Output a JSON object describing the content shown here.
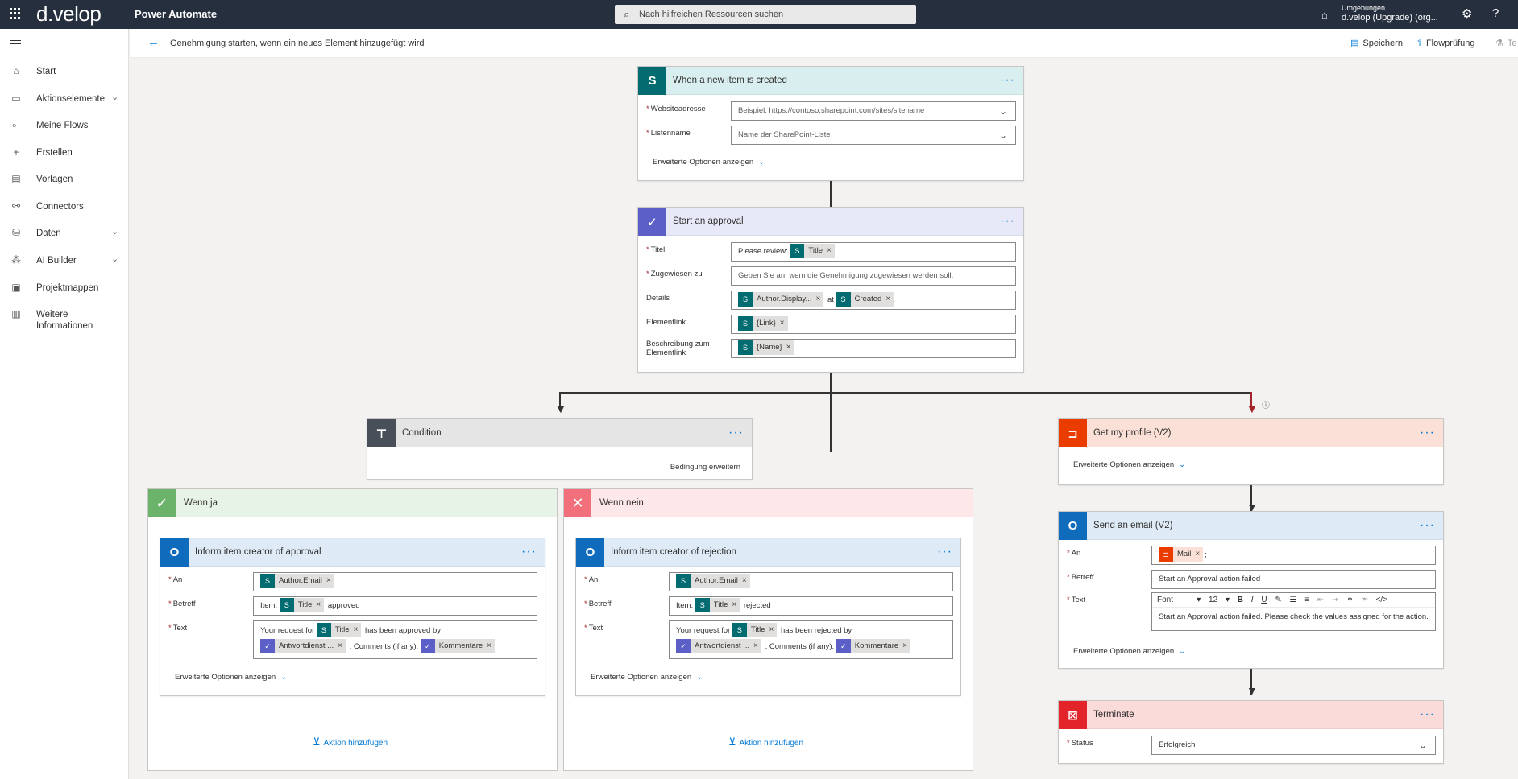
{
  "topbar": {
    "logo": "d.velop",
    "app_name": "Power Automate",
    "search_placeholder": "Nach hilfreichen Ressourcen suchen",
    "env_label": "Umgebungen",
    "env_name": "d.velop (Upgrade) (org..."
  },
  "nav": {
    "items": [
      {
        "label": "Start",
        "icon": "home-icon"
      },
      {
        "label": "Aktionselemente",
        "icon": "clipboard-icon",
        "expandable": true
      },
      {
        "label": "Meine Flows",
        "icon": "flow-icon"
      },
      {
        "label": "Erstellen",
        "icon": "plus-icon"
      },
      {
        "label": "Vorlagen",
        "icon": "template-icon"
      },
      {
        "label": "Connectors",
        "icon": "connector-icon"
      },
      {
        "label": "Daten",
        "icon": "database-icon",
        "expandable": true
      },
      {
        "label": "AI Builder",
        "icon": "ai-icon",
        "expandable": true
      },
      {
        "label": "Projektmappen",
        "icon": "solution-icon"
      },
      {
        "label": "Weitere",
        "label2": "Informationen",
        "icon": "book-icon"
      }
    ]
  },
  "cmdbar": {
    "title": "Genehmigung starten, wenn ein neues Element hinzugefügt wird",
    "save": "Speichern",
    "check": "Flowprüfung",
    "test": "Te"
  },
  "trigger": {
    "title": "When a new item is created",
    "site_label": "Websiteadresse",
    "site_placeholder": "Beispiel: https://contoso.sharepoint.com/sites/sitename",
    "list_label": "Listenname",
    "list_placeholder": "Name der SharePoint-Liste",
    "advanced": "Erweiterte Optionen anzeigen"
  },
  "approval": {
    "title": "Start an approval",
    "titel_label": "Titel",
    "titel_prefix": "Please review:",
    "titel_token": "Title",
    "assigned_label": "Zugewiesen zu",
    "assigned_placeholder": "Geben Sie an, wem die Genehmigung zugewiesen werden soll.",
    "details_label": "Details",
    "details_token1": "Author.Display...",
    "details_mid": "at",
    "details_token2": "Created",
    "link_label": "Elementlink",
    "link_token": "{Link}",
    "desc_label1": "Beschreibung zum",
    "desc_label2": "Elementlink",
    "desc_token": "{Name}"
  },
  "condition": {
    "title": "Condition",
    "expand": "Bedingung erweitern"
  },
  "yes_branch": {
    "title": "Wenn ja",
    "action_title": "Inform item creator of approval",
    "an_label": "An",
    "an_token": "Author.Email",
    "betreff_label": "Betreff",
    "betreff_prefix": "Item:",
    "betreff_token": "Title",
    "betreff_suffix": "approved",
    "text_label": "Text",
    "text_prefix": "Your request for",
    "text_token": "Title",
    "text_mid": "has been approved by",
    "text_token2": "Antwortdienst ...",
    "text_mid2": ". Comments (if any):",
    "text_token3": "Kommentare",
    "advanced": "Erweiterte Optionen anzeigen",
    "add_action": "Aktion hinzufügen"
  },
  "no_branch": {
    "title": "Wenn nein",
    "action_title": "Inform item creator of rejection",
    "an_label": "An",
    "an_token": "Author.Email",
    "betreff_label": "Betreff",
    "betreff_prefix": "Item:",
    "betreff_token": "Title",
    "betreff_suffix": "rejected",
    "text_label": "Text",
    "text_prefix": "Your request for",
    "text_token": "Title",
    "text_mid": "has been rejected by",
    "text_token2": "Antwortdienst ...",
    "text_mid2": ". Comments (if any):",
    "text_token3": "Kommentare",
    "advanced": "Erweiterte Optionen anzeigen",
    "add_action": "Aktion hinzufügen"
  },
  "profile": {
    "title": "Get my profile (V2)",
    "advanced": "Erweiterte Optionen anzeigen"
  },
  "email": {
    "title": "Send an email (V2)",
    "an_label": "An",
    "an_token": "Mail",
    "an_suffix": ";",
    "betreff_label": "Betreff",
    "betreff_value": "Start an Approval action failed",
    "text_label": "Text",
    "font": "Font",
    "size": "12",
    "body": "Start an Approval action failed. Please check the values assigned for the action.",
    "advanced": "Erweiterte Optionen anzeigen"
  },
  "terminate": {
    "title": "Terminate",
    "status_label": "Status",
    "status_value": "Erfolgreich"
  },
  "colors": {
    "sharepoint": "#036c70",
    "approval": "#5b5fc7",
    "condition": "#484f58",
    "office": "#eb3c00",
    "outlook": "#0f6cbd",
    "terminate": "#e3242b",
    "accent": "#0078d4"
  }
}
